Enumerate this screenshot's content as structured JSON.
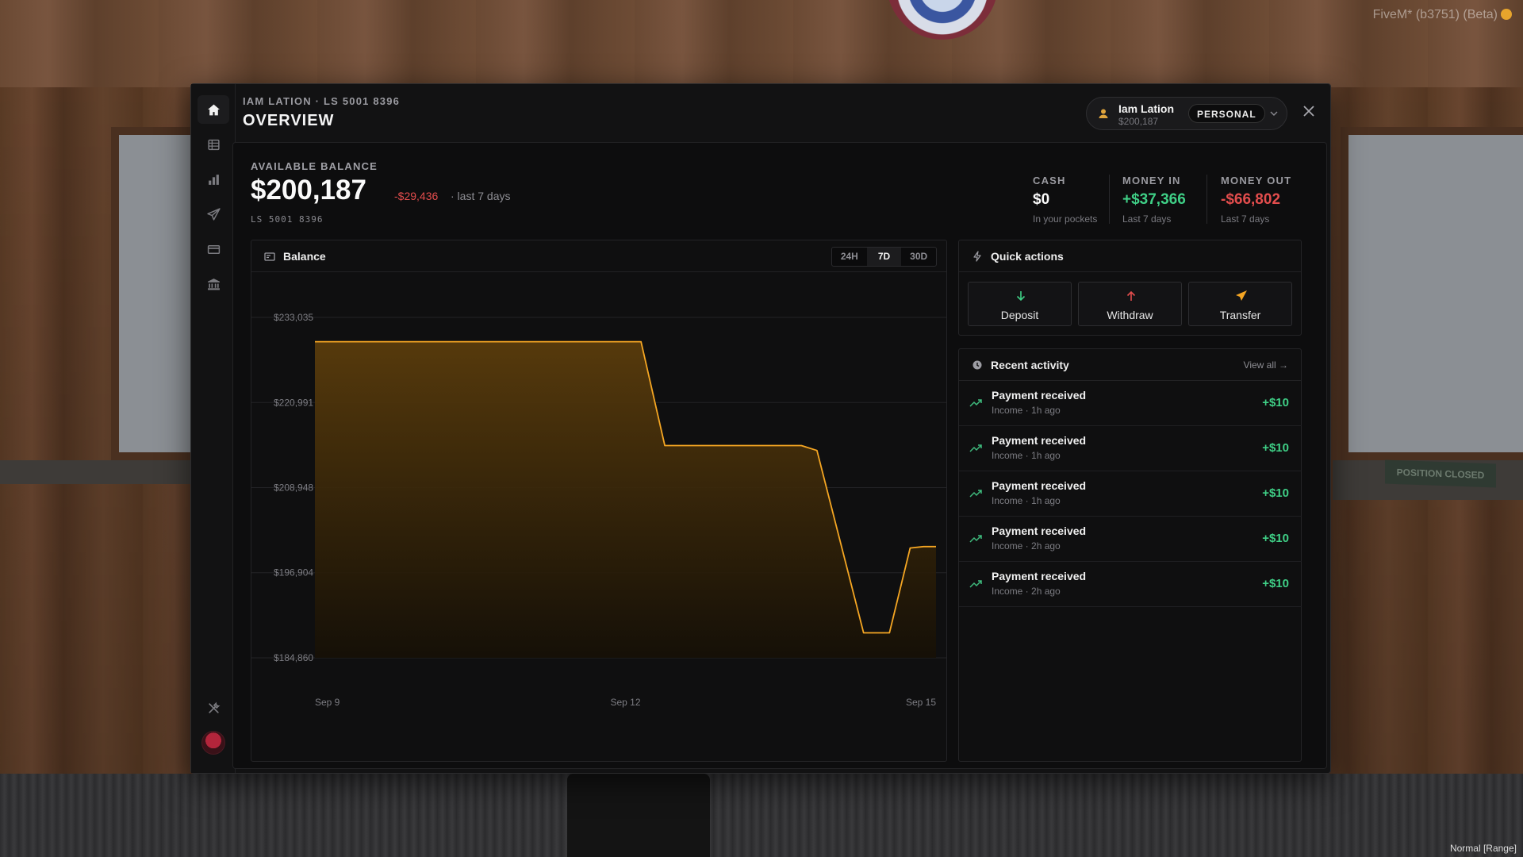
{
  "game": {
    "client_label": "FiveM* (b3751) (Beta)",
    "voice_mode": "Normal [Range]",
    "sign_text": "POSITION CLOSED"
  },
  "header": {
    "subtitle": "IAM LATION · LS 5001 8396",
    "title": "OVERVIEW"
  },
  "account_switcher": {
    "name": "Iam Lation",
    "balance": "$200,187",
    "type": "PERSONAL"
  },
  "sidebar": {
    "items": [
      {
        "icon": "home-icon",
        "active": true
      },
      {
        "icon": "transactions-icon",
        "active": false
      },
      {
        "icon": "analytics-icon",
        "active": false
      },
      {
        "icon": "send-icon",
        "active": false
      },
      {
        "icon": "card-icon",
        "active": false
      },
      {
        "icon": "bank-icon",
        "active": false
      }
    ],
    "bottom_icon": "tools-icon"
  },
  "balance": {
    "label": "AVAILABLE BALANCE",
    "amount": "$200,187",
    "change": "-$29,436",
    "period": "· last 7 days",
    "account_number": "LS 5001 8396"
  },
  "stats": {
    "cash": {
      "label": "CASH",
      "value": "$0",
      "note": "In your pockets"
    },
    "money_in": {
      "label": "MONEY IN",
      "value": "+$37,366",
      "note": "Last 7 days"
    },
    "money_out": {
      "label": "MONEY OUT",
      "value": "-$66,802",
      "note": "Last 7 days"
    }
  },
  "chart_card": {
    "title": "Balance",
    "ranges": [
      "24H",
      "7D",
      "30D"
    ],
    "selected_range": "7D"
  },
  "chart_data": {
    "type": "area",
    "title": "Balance",
    "xlabel": "",
    "ylabel": "",
    "y_ticks": [
      "$233,035",
      "$220,991",
      "$208,948",
      "$196,904",
      "$184,860"
    ],
    "y_tick_values": [
      233035,
      220991,
      208948,
      196904,
      184860
    ],
    "x_ticks": [
      "Sep 9",
      "Sep 12",
      "Sep 15"
    ],
    "x_tick_values": [
      9,
      12,
      15
    ],
    "ylim": [
      184860,
      233035
    ],
    "xlim": [
      9,
      15
    ],
    "grid": true,
    "series": [
      {
        "x": [
          9.0,
          12.15,
          12.38,
          13.7,
          13.85,
          14.3,
          14.55,
          14.75,
          14.88,
          15.0
        ],
        "y": [
          229600,
          229600,
          214900,
          214900,
          214200,
          188400,
          188400,
          200400,
          200600,
          200600
        ]
      }
    ],
    "colors": {
      "line": "#f5a623",
      "fill_top": "#5a3c0c",
      "fill_bottom": "#161006"
    }
  },
  "quick_actions": {
    "title": "Quick actions",
    "buttons": [
      {
        "label": "Deposit",
        "icon": "arrow-down-icon",
        "color": "#3fcf86"
      },
      {
        "label": "Withdraw",
        "icon": "arrow-up-icon",
        "color": "#e34d4d"
      },
      {
        "label": "Transfer",
        "icon": "send-icon",
        "color": "#f5a623"
      }
    ]
  },
  "recent_activity": {
    "title": "Recent activity",
    "view_all": "View all →",
    "items": [
      {
        "title": "Payment received",
        "sub": "Income · 1h ago",
        "amount": "+$10"
      },
      {
        "title": "Payment received",
        "sub": "Income · 1h ago",
        "amount": "+$10"
      },
      {
        "title": "Payment received",
        "sub": "Income · 1h ago",
        "amount": "+$10"
      },
      {
        "title": "Payment received",
        "sub": "Income · 2h ago",
        "amount": "+$10"
      },
      {
        "title": "Payment received",
        "sub": "Income · 2h ago",
        "amount": "+$10"
      }
    ]
  }
}
